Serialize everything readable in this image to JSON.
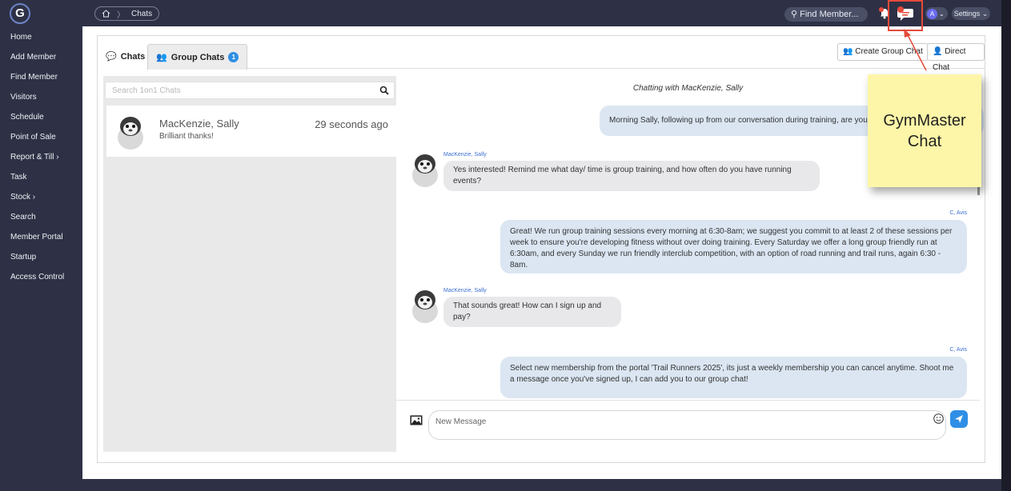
{
  "app": {
    "logo_letter": "G",
    "breadcrumb": {
      "home_icon": "home-icon",
      "current": "Chats"
    },
    "find_member_placeholder": "Find Member...",
    "avatar_initial": "A",
    "settings_label": "Settings"
  },
  "sidebar": {
    "items": [
      {
        "label": "Home"
      },
      {
        "label": "Add Member"
      },
      {
        "label": "Find Member"
      },
      {
        "label": "Visitors"
      },
      {
        "label": "Schedule"
      },
      {
        "label": "Point of Sale"
      },
      {
        "label": "Report & Till ›"
      },
      {
        "label": "Task"
      },
      {
        "label": "Stock ›"
      },
      {
        "label": "Search"
      },
      {
        "label": "Member Portal"
      },
      {
        "label": "Startup"
      },
      {
        "label": "Access Control"
      }
    ]
  },
  "tabs": {
    "chats": "Chats",
    "group_chats": "Group Chats",
    "group_chats_badge": "1"
  },
  "actions": {
    "create_group_chat": "Create Group Chat",
    "direct_chat": "Direct Chat"
  },
  "chat_list": {
    "search_placeholder": "Search 1on1 Chats",
    "items": [
      {
        "name": "MacKenzie, Sally",
        "preview": "Brilliant thanks!",
        "time": "29 seconds ago"
      }
    ]
  },
  "conversation": {
    "title": "Chatting with MacKenzie, Sally",
    "messages": [
      {
        "direction": "out",
        "sender": "",
        "text": "Morning Sally, following up from our conversation during training, are you re"
      },
      {
        "direction": "in",
        "sender": "MacKenzie, Sally",
        "text": "Yes interested! Remind me what day/ time is group training, and how often do you have running events?"
      },
      {
        "direction": "out",
        "sender": "C, Avis",
        "text": "Great! We run group training sessions every morning at 6:30-8am; we suggest you commit to at least 2 of these sessions per week to ensure you're developing fitness without over doing training. Every Saturday we offer a long group friendly run at 6:30am, and every Sunday we run friendly interclub competition, with an option of road running and trail runs, again 6:30 - 8am."
      },
      {
        "direction": "in",
        "sender": "MacKenzie, Sally",
        "text": "That sounds great! How can I sign up and pay?"
      },
      {
        "direction": "out",
        "sender": "C, Avis",
        "text": "Select new membership from the portal 'Trail Runners 2025', its just a weekly membership you can cancel anytime. Shoot me a message once you've signed up, I can add you to our group chat!"
      }
    ],
    "composer_placeholder": "New Message"
  },
  "annotation": {
    "note_text": "GymMaster Chat",
    "note_color": "#fdf6a8",
    "highlight_color": "#e64a3a"
  }
}
